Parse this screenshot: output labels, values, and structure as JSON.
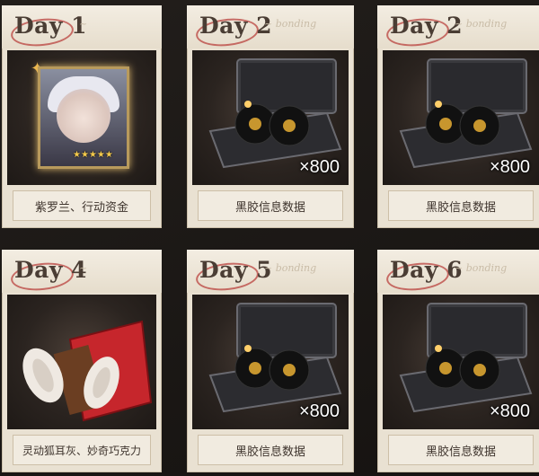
{
  "rewards": [
    {
      "day": "Day 1",
      "caption": "紫罗兰、行动资金",
      "qty": "",
      "icon": "character-portrait",
      "stars": "★★★★★"
    },
    {
      "day": "Day 2",
      "caption": "黑胶信息数据",
      "qty": "×800",
      "icon": "vinyl-briefcase"
    },
    {
      "day": "Day 2",
      "caption": "黑胶信息数据",
      "qty": "×800",
      "icon": "vinyl-briefcase"
    },
    {
      "day": "Day 4",
      "caption": "灵动狐耳灰、妙奇巧克力",
      "qty": "",
      "icon": "fox-ears-chocolate"
    },
    {
      "day": "Day 5",
      "caption": "黑胶信息数据",
      "qty": "×800",
      "icon": "vinyl-briefcase"
    },
    {
      "day": "Day 6",
      "caption": "黑胶信息数据",
      "qty": "×800",
      "icon": "vinyl-briefcase"
    }
  ],
  "colors": {
    "card_bg": "#e9e1d2",
    "title_text": "#4a3d34",
    "circle_mark": "#b9413e",
    "art_bg": "#2b2420"
  }
}
